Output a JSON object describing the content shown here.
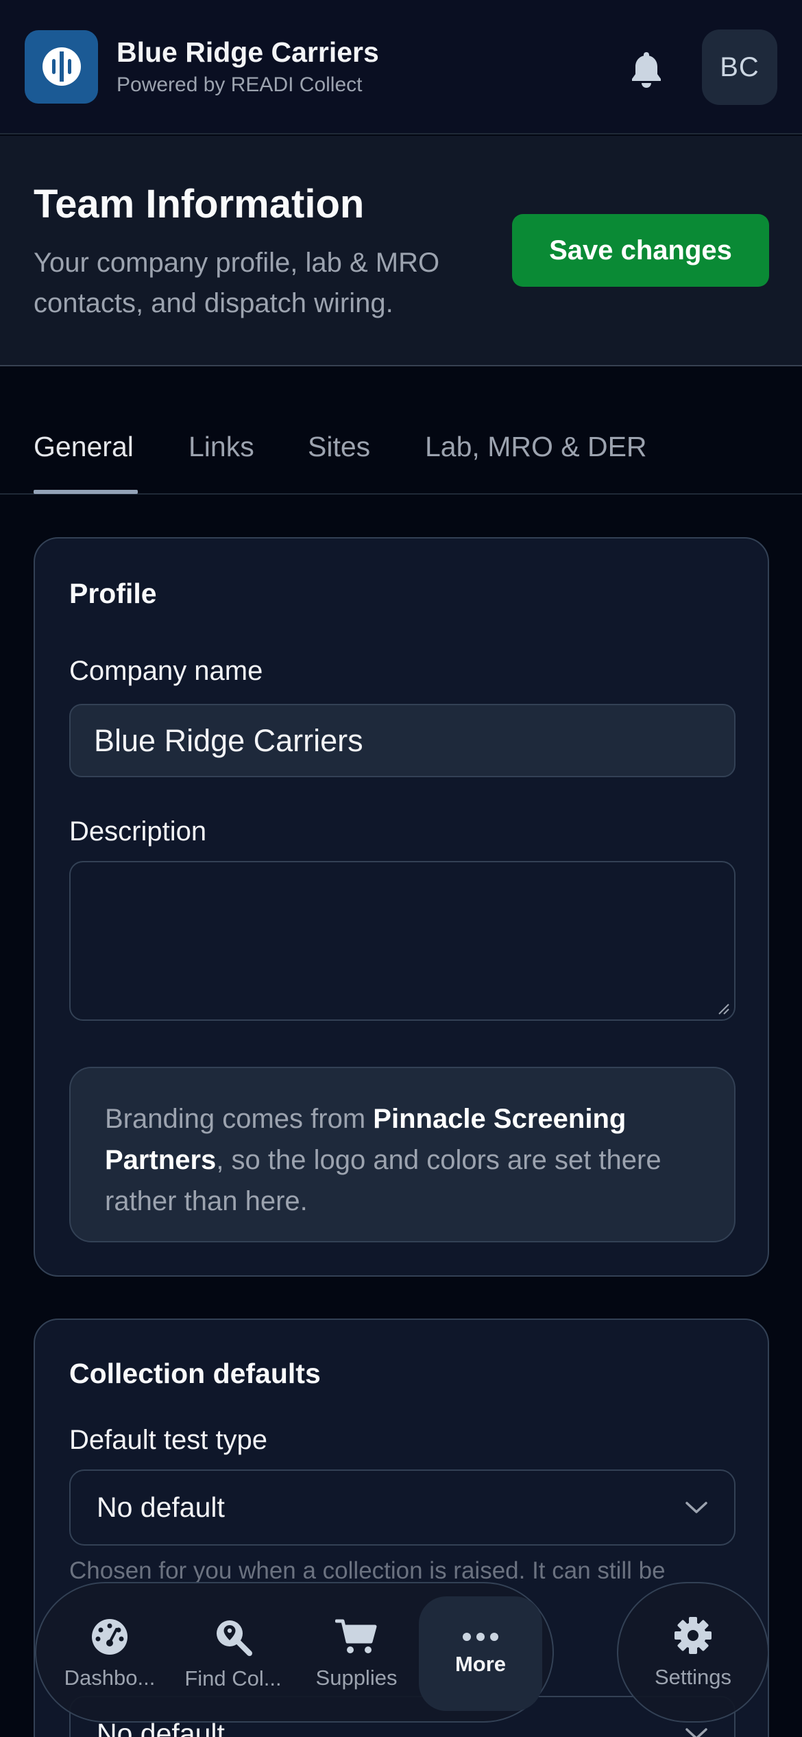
{
  "app": {
    "name": "Blue Ridge Carriers",
    "subtitle": "Powered by READI Collect",
    "avatar_initials": "BC",
    "brand_color": "#1b5a95"
  },
  "header": {
    "title": "Team Information",
    "description": "Your company profile, lab & MRO contacts, and dispatch wiring.",
    "save_label": "Save changes",
    "save_color": "#0a8a35"
  },
  "tabs": [
    {
      "label": "General",
      "active": true
    },
    {
      "label": "Links",
      "active": false
    },
    {
      "label": "Sites",
      "active": false
    },
    {
      "label": "Lab, MRO & DER",
      "active": false
    }
  ],
  "profile": {
    "title": "Profile",
    "company_label": "Company name",
    "company_value": "Blue Ridge Carriers",
    "description_label": "Description",
    "description_value": "",
    "branding_prefix": "Branding comes from ",
    "branding_source": "Pinnacle Screening Partners",
    "branding_suffix": ", so the logo and colors are set there rather than here."
  },
  "collection_defaults": {
    "title": "Collection defaults",
    "test_type_label": "Default test type",
    "test_type_value": "No default",
    "test_type_help": "Chosen for you when a collection is raised. It can still be",
    "second_select_value": "No default"
  },
  "bottom_nav": {
    "items": [
      {
        "label": "Dashbo...",
        "icon": "gauge-icon"
      },
      {
        "label": "Find Col...",
        "icon": "location-search-icon"
      },
      {
        "label": "Supplies",
        "icon": "cart-icon"
      },
      {
        "label": "More",
        "icon": "more-dots-icon",
        "active": true
      }
    ],
    "settings_label": "Settings"
  }
}
